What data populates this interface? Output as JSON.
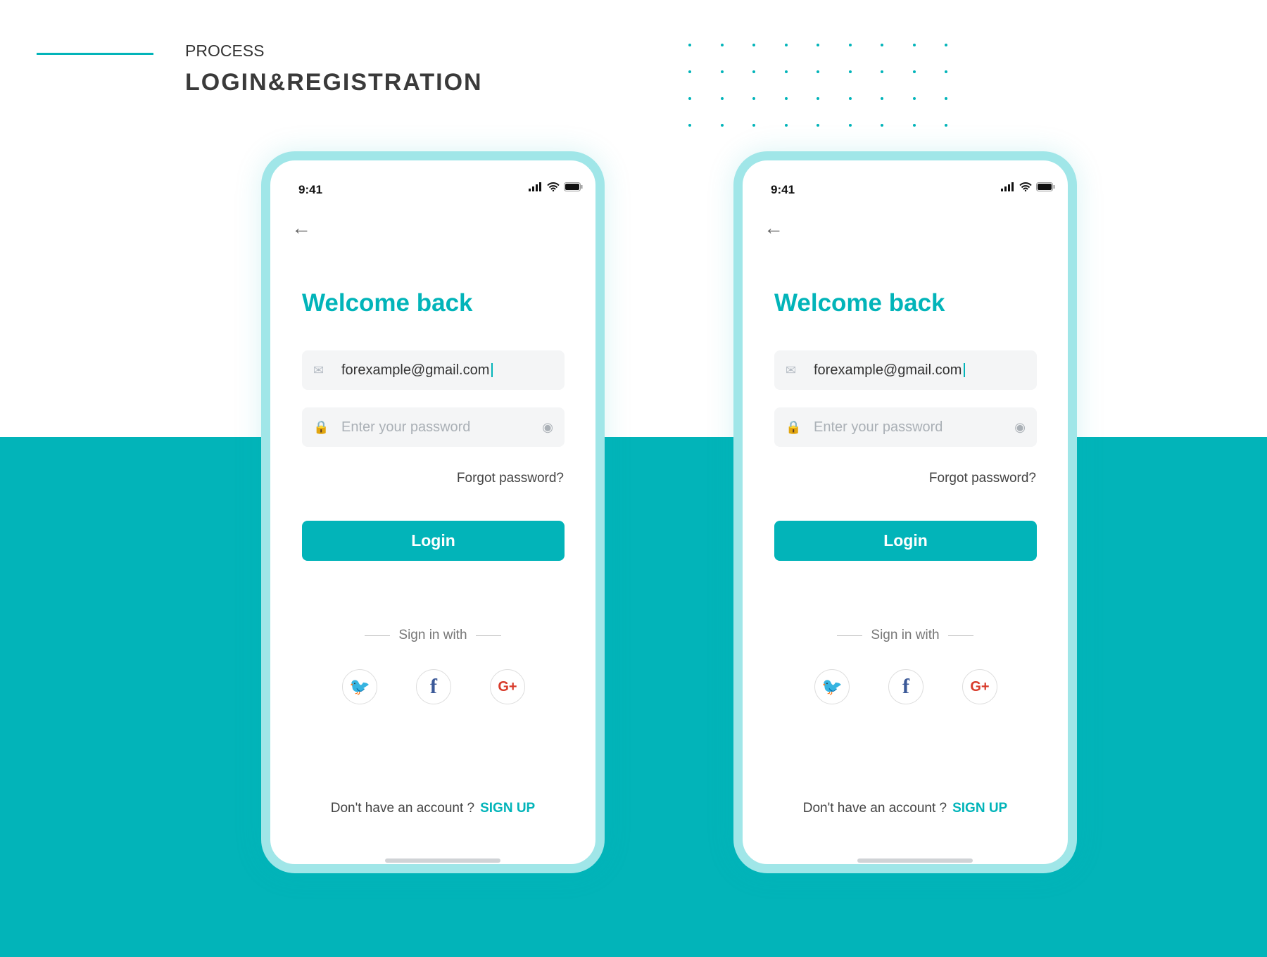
{
  "header": {
    "eyebrow": "PROCESS",
    "title": "LOGIN&REGISTRATION"
  },
  "colors": {
    "accent": "#02b4b9",
    "phone_frame": "#a0e6e8"
  },
  "phones": [
    {
      "time": "9:41",
      "welcome": "Welcome back",
      "email_value": "forexample@gmail.com",
      "password_placeholder": "Enter your password",
      "forgot": "Forgot password?",
      "login": "Login",
      "sign_in_with": "Sign in with",
      "no_account": "Don't have an account ?",
      "sign_up": "SIGN UP"
    },
    {
      "time": "9:41",
      "welcome": "Welcome back",
      "email_value": "forexample@gmail.com",
      "password_placeholder": "Enter your password",
      "forgot": "Forgot password?",
      "login": "Login",
      "sign_in_with": "Sign in with",
      "no_account": "Don't have an account ?",
      "sign_up": "SIGN UP"
    }
  ],
  "icons": {
    "back": "arrow-left-icon",
    "email": "envelope-icon",
    "password": "lock-icon",
    "reveal": "eye-icon",
    "social": [
      "twitter-icon",
      "facebook-icon",
      "google-plus-icon"
    ]
  }
}
